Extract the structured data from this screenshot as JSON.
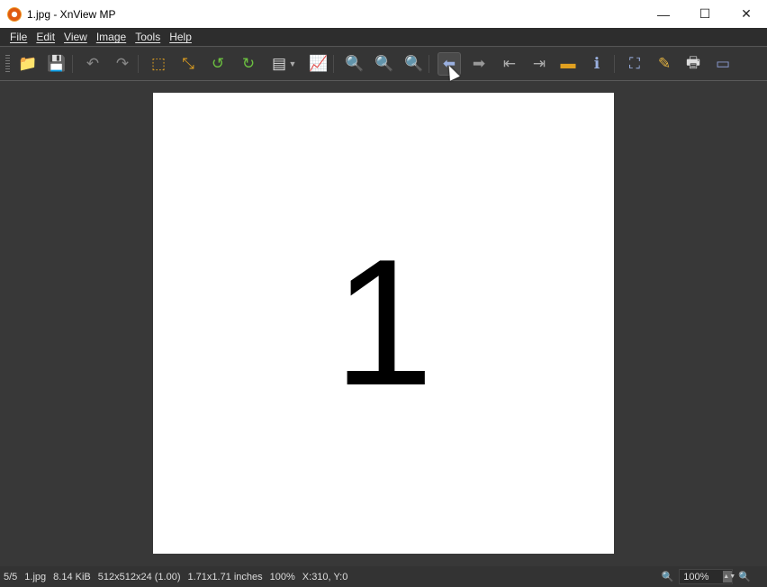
{
  "window": {
    "title": "1.jpg - XnView MP",
    "minimize": "—",
    "maximize": "☐",
    "close": "✕"
  },
  "menu": [
    "File",
    "Edit",
    "View",
    "Image",
    "Tools",
    "Help"
  ],
  "toolbar": [
    {
      "name": "browser",
      "glyph": "📁",
      "color": "#f0c040"
    },
    {
      "name": "save",
      "glyph": "💾",
      "color": "#7a8ad0"
    },
    {
      "name": "undo",
      "glyph": "↶",
      "color": "#888"
    },
    {
      "name": "redo",
      "glyph": "↷",
      "color": "#888"
    },
    {
      "name": "crop",
      "glyph": "⬚",
      "color": "#e0a020"
    },
    {
      "name": "resize",
      "glyph": "⤡",
      "color": "#e0a020"
    },
    {
      "name": "rotate-left",
      "glyph": "↺",
      "color": "#6cc040"
    },
    {
      "name": "rotate-right",
      "glyph": "↻",
      "color": "#6cc040"
    },
    {
      "name": "adjust",
      "glyph": "▤",
      "color": "#ddd"
    },
    {
      "name": "levels",
      "glyph": "📈",
      "color": "#ddd"
    },
    {
      "name": "zoom-in",
      "glyph": "🔍",
      "color": "#ddd"
    },
    {
      "name": "zoom-fit",
      "glyph": "🔍",
      "color": "#ddd"
    },
    {
      "name": "zoom-out",
      "glyph": "🔍",
      "color": "#ddd"
    },
    {
      "name": "previous",
      "glyph": "⬅",
      "color": "#9ab0e0"
    },
    {
      "name": "next",
      "glyph": "➡",
      "color": "#999"
    },
    {
      "name": "first",
      "glyph": "⇤",
      "color": "#aaa"
    },
    {
      "name": "last",
      "glyph": "⇥",
      "color": "#aaa"
    },
    {
      "name": "wallpaper",
      "glyph": "▬",
      "color": "#e0a020"
    },
    {
      "name": "info",
      "glyph": "ℹ",
      "color": "#9ab0e0"
    },
    {
      "name": "fullscreen",
      "glyph": "⛶",
      "color": "#9ab0e0"
    },
    {
      "name": "edit",
      "glyph": "✎",
      "color": "#e0b040"
    },
    {
      "name": "print",
      "glyph": "🖶",
      "color": "#ddd"
    },
    {
      "name": "scan",
      "glyph": "▭",
      "color": "#8a9ad0"
    }
  ],
  "image": {
    "content": "1"
  },
  "status": {
    "index": "5/5",
    "filename": "1.jpg",
    "filesize": "8.14 KiB",
    "dimensions": "512x512x24 (1.00)",
    "print_size": "1.71x1.71 inches",
    "zoom": "100%",
    "coords": "X:310, Y:0"
  },
  "zoom_control": {
    "value": "100%",
    "zoom_in": "🔍",
    "zoom_out": "🔍"
  }
}
